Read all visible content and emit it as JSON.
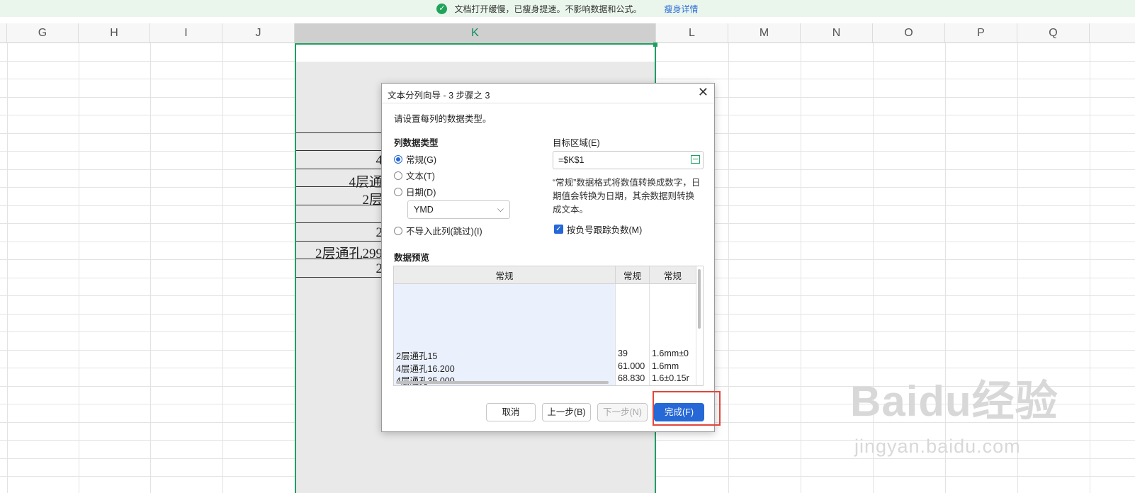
{
  "notification": {
    "message": "文档打开缓慢，已瘦身提速。不影响数据和公式。",
    "link": "瘦身详情"
  },
  "columns": [
    "G",
    "H",
    "I",
    "J",
    "K",
    "L",
    "M",
    "N",
    "O",
    "P",
    "Q"
  ],
  "selected_column": "K",
  "sheet_cells": [
    "4",
    "4层通",
    "2层",
    "2",
    "2层通孔299",
    "2"
  ],
  "dialog": {
    "title": "文本分列向导 - 3 步骤之 3",
    "instruction": "请设置每列的数据类型。",
    "column_type_heading": "列数据类型",
    "radios": [
      {
        "label": "常规(G)",
        "checked": true
      },
      {
        "label": "文本(T)",
        "checked": false
      },
      {
        "label": "日期(D)",
        "checked": false
      },
      {
        "label": "不导入此列(跳过)(I)",
        "checked": false
      }
    ],
    "date_format": "YMD",
    "target_label": "目标区域(E)",
    "target_value": "=$K$1",
    "description": "“常规”数据格式将数值转换成数字，日期值会转换为日期，其余数据则转换成文本。",
    "checkbox_label": "按负号跟踪负数(M)",
    "checkbox_checked": true,
    "preview_heading": "数据预览",
    "preview_headers": [
      "常规",
      "常规",
      "常规"
    ],
    "preview_rows": [
      [
        "2层通孔15",
        "39",
        "1.6mm±0"
      ],
      [
        "4层通孔16.200",
        "61.000",
        "1.6mm"
      ],
      [
        "4层通孔35.000",
        "68.830",
        "1.6±0.15r"
      ]
    ],
    "buttons": {
      "cancel": "取消",
      "back": "上一步(B)",
      "next": "下一步(N)",
      "finish": "完成(F)"
    }
  },
  "watermark": {
    "brand": "Baidu经验",
    "url": "jingyan.baidu.com"
  },
  "colors": {
    "accent": "#2668d6",
    "selection": "#1f9e63",
    "highlight": "#e0463c"
  }
}
